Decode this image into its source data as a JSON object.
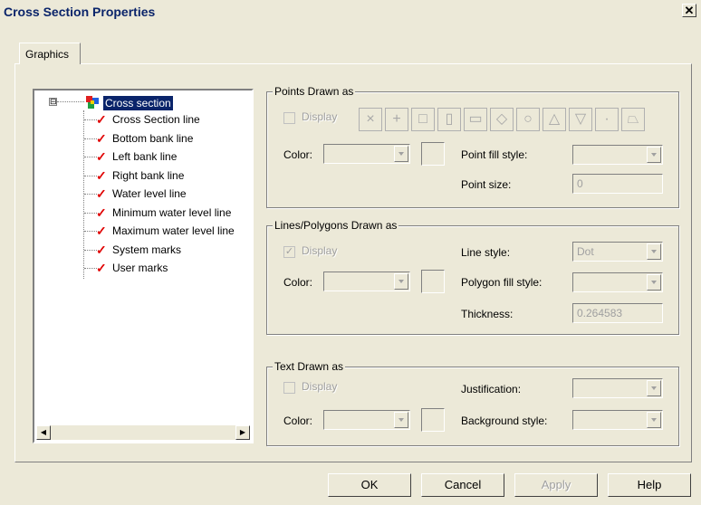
{
  "window": {
    "title": "Cross Section Properties",
    "close_glyph": "✕"
  },
  "tabs": [
    {
      "label": "Graphics"
    }
  ],
  "tree": {
    "root": {
      "label": "Cross section",
      "expander": "⊟",
      "icon": "cross-section-icon"
    },
    "items": [
      {
        "label": "Cross Section line",
        "checked": true
      },
      {
        "label": "Bottom bank line",
        "checked": true
      },
      {
        "label": "Left bank line",
        "checked": true
      },
      {
        "label": "Right bank line",
        "checked": true
      },
      {
        "label": "Water level line",
        "checked": true
      },
      {
        "label": "Minimum water level line",
        "checked": true
      },
      {
        "label": "Maximum water level line",
        "checked": true
      },
      {
        "label": "System marks",
        "checked": true
      },
      {
        "label": "User marks",
        "checked": true
      }
    ],
    "check_glyph": "✓",
    "scroll_left_glyph": "◀",
    "scroll_right_glyph": "▶"
  },
  "points": {
    "group_title": "Points Drawn as",
    "display_label": "Display",
    "display_checked": false,
    "color_label": "Color:",
    "fill_style_label": "Point fill style:",
    "size_label": "Point size:",
    "size_value": "0",
    "symbols": [
      "×",
      "+",
      "□",
      "▯",
      "▭",
      "◇",
      "○",
      "△",
      "▽",
      "·",
      "⏢"
    ]
  },
  "lines": {
    "group_title": "Lines/Polygons Drawn as",
    "display_label": "Display",
    "display_checked": true,
    "check_mark": "✓",
    "color_label": "Color:",
    "line_style_label": "Line style:",
    "line_style_value": "Dot",
    "polygon_fill_label": "Polygon fill style:",
    "thickness_label": "Thickness:",
    "thickness_value": "0.264583"
  },
  "text": {
    "group_title": "Text Drawn as",
    "display_label": "Display",
    "display_checked": false,
    "color_label": "Color:",
    "justification_label": "Justification:",
    "background_label": "Background style:"
  },
  "buttons": {
    "ok": "OK",
    "cancel": "Cancel",
    "apply": "Apply",
    "help": "Help"
  }
}
